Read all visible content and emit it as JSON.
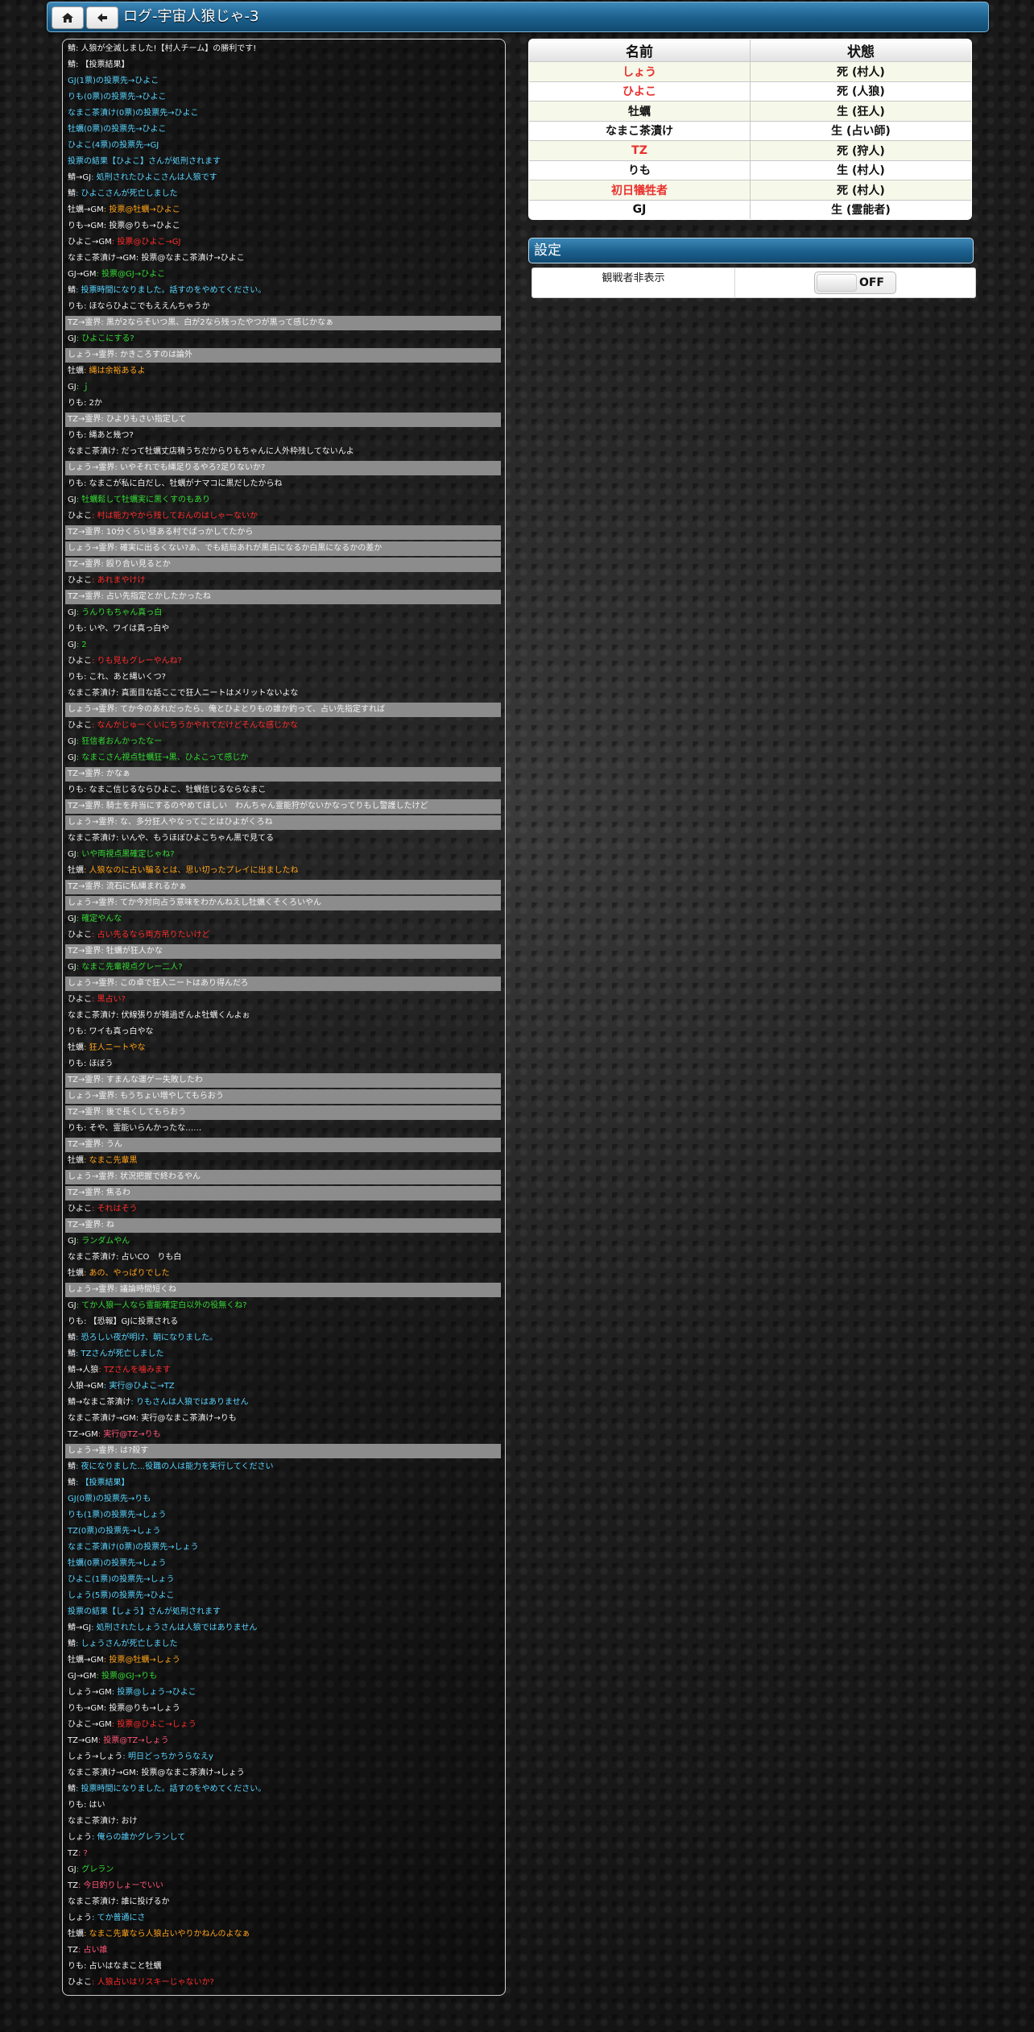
{
  "header": {
    "title": "ログ-宇宙人狼じゃ-3",
    "home_icon": "home-icon",
    "back_icon": "arrow-left-icon"
  },
  "players": {
    "headers": [
      "名前",
      "状態"
    ],
    "rows": [
      {
        "name": "しょう",
        "status": "死 (村人)",
        "name_color": "#e8312e"
      },
      {
        "name": "ひよこ",
        "status": "死 (人狼)",
        "name_color": "#e8312e"
      },
      {
        "name": "牡蠣",
        "status": "生 (狂人)",
        "name_color": "#111111"
      },
      {
        "name": "なまこ茶漬け",
        "status": "生 (占い師)",
        "name_color": "#111111"
      },
      {
        "name": "TZ",
        "status": "死 (狩人)",
        "name_color": "#e8312e"
      },
      {
        "name": "りも",
        "status": "生 (村人)",
        "name_color": "#111111"
      },
      {
        "name": "初日犠牲者",
        "status": "死 (村人)",
        "name_color": "#e8312e"
      },
      {
        "name": "GJ",
        "status": "生 (霊能者)",
        "name_color": "#111111"
      }
    ]
  },
  "settings": {
    "title": "設定",
    "observer_hide_label": "観戦者非表示",
    "observer_hide_value": "OFF"
  },
  "log": [
    {
      "s": "鯖",
      "t": ": 人狼が全滅しました!【村人チーム】の勝利です!",
      "c": "c-white",
      "sys": true
    },
    {
      "s": "鯖",
      "t": ": 【投票結果】",
      "c": "c-white",
      "sys": true
    },
    {
      "s": "",
      "t": "GJ(1票)の投票先→ひよこ",
      "c": "c-cyan"
    },
    {
      "s": "",
      "t": "りも(0票)の投票先→ひよこ",
      "c": "c-cyan"
    },
    {
      "s": "",
      "t": "なまこ茶漬け(0票)の投票先→ひよこ",
      "c": "c-cyan"
    },
    {
      "s": "",
      "t": "牡蠣(0票)の投票先→ひよこ",
      "c": "c-cyan"
    },
    {
      "s": "",
      "t": "ひよこ(4票)の投票先→GJ",
      "c": "c-cyan"
    },
    {
      "s": "",
      "t": "投票の結果【ひよこ】さんが処刑されます",
      "c": "c-cyan"
    },
    {
      "s": "鯖→GJ",
      "t": ": 処刑されたひよこさんは人狼です",
      "c": "c-cyan"
    },
    {
      "s": "鯖",
      "t": ": ひよこさんが死亡しました",
      "c": "c-cyan"
    },
    {
      "s": "牡蠣→GM",
      "t": ": 投票@牡蠣→ひよこ",
      "c": "c-orange"
    },
    {
      "s": "りも→GM",
      "t": ": 投票@りも→ひよこ",
      "c": "c-white"
    },
    {
      "s": "ひよこ→GM",
      "t": ": 投票@ひよこ→GJ",
      "c": "c-red"
    },
    {
      "s": "なまこ茶漬け→GM",
      "t": ": 投票@なまこ茶漬け→ひよこ",
      "c": "c-white"
    },
    {
      "s": "GJ→GM",
      "t": ": 投票@GJ→ひよこ",
      "c": "c-green"
    },
    {
      "s": "鯖",
      "t": ": 投票時間になりました。話すのをやめてください。",
      "c": "c-cyan"
    },
    {
      "s": "りも",
      "t": ": ほならひよこでもええんちゃうか",
      "c": "c-white"
    },
    {
      "s": "TZ→霊界",
      "t": ": 黒が2ならそいつ黒、白が2なら残ったやつが黒って感じかなぁ",
      "c": "c-white",
      "hl": true
    },
    {
      "s": "GJ",
      "t": ": ひよこにする?",
      "c": "c-green"
    },
    {
      "s": "しょう→霊界",
      "t": ": かきころすのは論外",
      "c": "c-white",
      "hl": true
    },
    {
      "s": "牡蠣",
      "t": ": 縄は余裕あるよ",
      "c": "c-orange"
    },
    {
      "s": "GJ",
      "t": ": ｊ",
      "c": "c-green"
    },
    {
      "s": "りも",
      "t": ": 2か",
      "c": "c-white"
    },
    {
      "s": "TZ→霊界",
      "t": ": ひよりもさい指定して",
      "c": "c-white",
      "hl": true
    },
    {
      "s": "りも",
      "t": ": 縄あと幾つ?",
      "c": "c-white"
    },
    {
      "s": "なまこ茶漬け",
      "t": ": だって牡蠣丈店積うちだからりもちゃんに人外枠残してないんよ",
      "c": "c-white"
    },
    {
      "s": "しょう→霊界",
      "t": ": いやそれでも縄足りるやろ?足りないか?",
      "c": "c-white",
      "hl": true
    },
    {
      "s": "りも",
      "t": ": なまこが私に白だし、牡蠣がナマコに黒だしたからね",
      "c": "c-white"
    },
    {
      "s": "GJ",
      "t": ": 牡蠣鬆して牡蠣実に黒くすのもあり",
      "c": "c-green"
    },
    {
      "s": "ひよこ",
      "t": ": 村は能力やから残しておんのはしゃーないか",
      "c": "c-red"
    },
    {
      "s": "TZ→霊界",
      "t": ": 10分くらい昼ある村でばっかしてたから",
      "c": "c-white",
      "hl": true
    },
    {
      "s": "しょう→霊界",
      "t": ": 確実に出るくない?あ、でも結局あれが黒白になるか白黒になるかの差か",
      "c": "c-white",
      "hl": true
    },
    {
      "s": "TZ→霊界",
      "t": ": 殴り合い見るとか",
      "c": "c-white",
      "hl": true
    },
    {
      "s": "ひよこ",
      "t": ": あれまやけけ",
      "c": "c-red"
    },
    {
      "s": "TZ→霊界",
      "t": ": 占い先指定とかしたかったね",
      "c": "c-white",
      "hl": true
    },
    {
      "s": "GJ",
      "t": ": うんりもちゃん真っ白",
      "c": "c-green"
    },
    {
      "s": "りも",
      "t": ": いや、ワイは真っ白や",
      "c": "c-white"
    },
    {
      "s": "GJ",
      "t": ": 2",
      "c": "c-green"
    },
    {
      "s": "ひよこ",
      "t": ": りも見もグレーやんね?",
      "c": "c-red"
    },
    {
      "s": "りも",
      "t": ": これ、あと縄いくつ?",
      "c": "c-white"
    },
    {
      "s": "なまこ茶漬け",
      "t": ": 真面目な話ここで狂人ニートはメリットないよな",
      "c": "c-white"
    },
    {
      "s": "しょう→霊界",
      "t": ": てか今のあれだったら、俺とひよとりもの誰か釣って、占い先指定すれば",
      "c": "c-white",
      "hl": true
    },
    {
      "s": "ひよこ",
      "t": ": なんかじゅーくいにちうかやれてだけどそんな感じかな",
      "c": "c-red"
    },
    {
      "s": "GJ",
      "t": ": 狂信者おんかったなー",
      "c": "c-green"
    },
    {
      "s": "GJ",
      "t": ": なまこさん視点牡蠣狂→黒、ひよこって感じか",
      "c": "c-green"
    },
    {
      "s": "TZ→霊界",
      "t": ": かなぁ",
      "c": "c-white",
      "hl": true
    },
    {
      "s": "りも",
      "t": ": なまこ信じるならひよこ、牡蠣信じるならなまこ",
      "c": "c-white"
    },
    {
      "s": "TZ→霊界",
      "t": ": 騎士を弁当にするのやめてほしい　わんちゃん霊能狩がないかなってりもし警護したけど",
      "c": "c-white",
      "hl": true
    },
    {
      "s": "しょう→霊界",
      "t": ": な、多分狂人やなってことはひよがくろね",
      "c": "c-white",
      "hl": true
    },
    {
      "s": "なまこ茶漬け",
      "t": ": いんや、もうほぼひよこちゃん黒で見てる",
      "c": "c-white"
    },
    {
      "s": "GJ",
      "t": ": いや両視点黒確定じゃね?",
      "c": "c-green"
    },
    {
      "s": "牡蠣",
      "t": ": 人狼なのに占い騙るとは、思い切ったプレイに出ましたね",
      "c": "c-orange"
    },
    {
      "s": "TZ→霊界",
      "t": ": 流石に私縄まれるかぁ",
      "c": "c-white",
      "hl": true
    },
    {
      "s": "しょう→霊界",
      "t": ": てか今対向占う意味をわかんねえし牡蠣くそくろいやん",
      "c": "c-white",
      "hl": true
    },
    {
      "s": "GJ",
      "t": ": 確定やんな",
      "c": "c-green"
    },
    {
      "s": "ひよこ",
      "t": ": 占い先るなら両方吊りたいけど",
      "c": "c-red"
    },
    {
      "s": "TZ→霊界",
      "t": ": 牡蠣が狂人かな",
      "c": "c-white",
      "hl": true
    },
    {
      "s": "GJ",
      "t": ": なまこ先輩視点グレー二人?",
      "c": "c-green"
    },
    {
      "s": "しょう→霊界",
      "t": ": この卓で狂人ニートはあり得んだろ",
      "c": "c-white",
      "hl": true
    },
    {
      "s": "ひよこ",
      "t": ": 黒占い?",
      "c": "c-red"
    },
    {
      "s": "なまこ茶漬け",
      "t": ": 伏線張りが雑過ぎんよ牡蠣くんよぉ",
      "c": "c-white"
    },
    {
      "s": "りも",
      "t": ": ワイも真っ白やな",
      "c": "c-white"
    },
    {
      "s": "牡蠣",
      "t": ": 狂人ニートやな",
      "c": "c-orange"
    },
    {
      "s": "りも",
      "t": ": ほぼう",
      "c": "c-white"
    },
    {
      "s": "TZ→霊界",
      "t": ": すまんな運ゲー失敗したわ",
      "c": "c-white",
      "hl": true
    },
    {
      "s": "しょう→霊界",
      "t": ": もうちょい増やしてもらおう",
      "c": "c-white",
      "hl": true
    },
    {
      "s": "TZ→霊界",
      "t": ": 後で長くしてもらおう",
      "c": "c-white",
      "hl": true
    },
    {
      "s": "りも",
      "t": ": そや、霊能いらんかったな……",
      "c": "c-white"
    },
    {
      "s": "TZ→霊界",
      "t": ": うん",
      "c": "c-white",
      "hl": true
    },
    {
      "s": "牡蠣",
      "t": ": なまこ先輩黒",
      "c": "c-orange"
    },
    {
      "s": "しょう→霊界",
      "t": ": 状況把握で終わるやん",
      "c": "c-white",
      "hl": true
    },
    {
      "s": "TZ→霊界",
      "t": ": 焦るわ",
      "c": "c-white",
      "hl": true
    },
    {
      "s": "ひよこ",
      "t": ": それはそう",
      "c": "c-red"
    },
    {
      "s": "TZ→霊界",
      "t": ": ね",
      "c": "c-white",
      "hl": true
    },
    {
      "s": "GJ",
      "t": ": ランダムやん",
      "c": "c-green"
    },
    {
      "s": "なまこ茶漬け",
      "t": ": 占いCO　りも白",
      "c": "c-white"
    },
    {
      "s": "牡蠣",
      "t": ": あの、やっぱりでした",
      "c": "c-orange"
    },
    {
      "s": "しょう→霊界",
      "t": ": 議論時間短くね",
      "c": "c-white",
      "hl": true
    },
    {
      "s": "GJ",
      "t": ": てか人狼一人なら霊能確定白以外の役無くね?",
      "c": "c-green"
    },
    {
      "s": "りも",
      "t": ": 【恐報】GJに投票される",
      "c": "c-white"
    },
    {
      "s": "鯖",
      "t": ": 恐ろしい夜が明け、朝になりました。",
      "c": "c-cyan"
    },
    {
      "s": "鯖",
      "t": ": TZさんが死亡しました",
      "c": "c-cyan"
    },
    {
      "s": "鯖→人狼",
      "t": ": TZさんを噛みます",
      "c": "c-red"
    },
    {
      "s": "人狼→GM",
      "t": ": 実行@ひよこ→TZ",
      "c": "c-cyan"
    },
    {
      "s": "鯖→なまこ茶漬け",
      "t": ": りもさんは人狼ではありません",
      "c": "c-cyan"
    },
    {
      "s": "なまこ茶漬け→GM",
      "t": ": 実行@なまこ茶漬け→りも",
      "c": "c-white"
    },
    {
      "s": "TZ→GM",
      "t": ": 実行@TZ→りも",
      "c": "c-pink"
    },
    {
      "s": "しょう→霊界",
      "t": ": は?殺す",
      "c": "c-white",
      "hl": true
    },
    {
      "s": "鯖",
      "t": ": 夜になりました...役職の人は能力を実行してください",
      "c": "c-cyan"
    },
    {
      "s": "鯖",
      "t": ": 【投票結果】",
      "c": "c-cyan"
    },
    {
      "s": "",
      "t": "GJ(0票)の投票先→りも",
      "c": "c-cyan"
    },
    {
      "s": "",
      "t": "りも(1票)の投票先→しょう",
      "c": "c-cyan"
    },
    {
      "s": "",
      "t": "TZ(0票)の投票先→しょう",
      "c": "c-cyan"
    },
    {
      "s": "",
      "t": "なまこ茶漬け(0票)の投票先→しょう",
      "c": "c-cyan"
    },
    {
      "s": "",
      "t": "牡蠣(0票)の投票先→しょう",
      "c": "c-cyan"
    },
    {
      "s": "",
      "t": "ひよこ(1票)の投票先→しょう",
      "c": "c-cyan"
    },
    {
      "s": "",
      "t": "しょう(5票)の投票先→ひよこ",
      "c": "c-cyan"
    },
    {
      "s": "",
      "t": "投票の結果【しょう】さんが処刑されます",
      "c": "c-cyan"
    },
    {
      "s": "鯖→GJ",
      "t": ": 処刑されたしょうさんは人狼ではありません",
      "c": "c-cyan"
    },
    {
      "s": "鯖",
      "t": ": しょうさんが死亡しました",
      "c": "c-cyan"
    },
    {
      "s": "牡蠣→GM",
      "t": ": 投票@牡蠣→しょう",
      "c": "c-orange"
    },
    {
      "s": "GJ→GM",
      "t": ": 投票@GJ→りも",
      "c": "c-green"
    },
    {
      "s": "しょう→GM",
      "t": ": 投票@しょう→ひよこ",
      "c": "c-cyan"
    },
    {
      "s": "りも→GM",
      "t": ": 投票@りも→しょう",
      "c": "c-white"
    },
    {
      "s": "ひよこ→GM",
      "t": ": 投票@ひよこ→しょう",
      "c": "c-red"
    },
    {
      "s": "TZ→GM",
      "t": ": 投票@TZ→しょう",
      "c": "c-pink"
    },
    {
      "s": "しょう→しょう",
      "t": ": 明日どっちかうらなえy",
      "c": "c-cyan"
    },
    {
      "s": "なまこ茶漬け→GM",
      "t": ": 投票@なまこ茶漬け→しょう",
      "c": "c-white"
    },
    {
      "s": "鯖",
      "t": ": 投票時間になりました。話すのをやめてください。",
      "c": "c-cyan"
    },
    {
      "s": "りも",
      "t": ": はい",
      "c": "c-white"
    },
    {
      "s": "なまこ茶漬け",
      "t": ": おけ",
      "c": "c-white"
    },
    {
      "s": "しょう",
      "t": ": 俺らの誰かグレランして",
      "c": "c-cyan"
    },
    {
      "s": "TZ",
      "t": ": ?",
      "c": "c-pink"
    },
    {
      "s": "GJ",
      "t": ": グレラン",
      "c": "c-green"
    },
    {
      "s": "TZ",
      "t": ": 今日釣りしょーでいい",
      "c": "c-pink"
    },
    {
      "s": "なまこ茶漬け",
      "t": ": 誰に投げるか",
      "c": "c-white"
    },
    {
      "s": "しょう",
      "t": ": てか普通にさ",
      "c": "c-cyan"
    },
    {
      "s": "牡蠣",
      "t": ": なまこ先輩なら人狼占いやりかねんのよなぁ",
      "c": "c-orange"
    },
    {
      "s": "TZ",
      "t": ": 占い誰",
      "c": "c-pink"
    },
    {
      "s": "りも",
      "t": ": 占いはなまこと牡蠣",
      "c": "c-white"
    },
    {
      "s": "ひよこ",
      "t": ": 人狼占いはリスキーじゃないか?",
      "c": "c-red"
    }
  ]
}
